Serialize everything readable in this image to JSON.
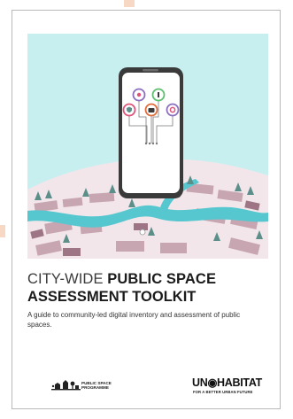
{
  "cover": {
    "title_light": "CITY-WIDE",
    "title_bold_1": "PUBLIC SPACE",
    "title_bold_2": "ASSESSMENT TOOLKIT",
    "subtitle": "A guide to community-led digital inventory and assessment of public spaces."
  },
  "logos": {
    "psp_line1": "PUBLIC SPACE",
    "psp_line2": "PROGRAMME",
    "unhabitat_name": "UN◉HABITAT",
    "unhabitat_tagline": "FOR A BETTER URBAN FUTURE"
  },
  "colors": {
    "sky": "#c8eff0",
    "river": "#56c7cf",
    "land": "#f2e6ea",
    "blocks": "#b9939f",
    "phone": "#3a3a3a",
    "title_text": "#1b1b1b"
  },
  "icons": [
    "pin-icon",
    "info-icon",
    "shield-icon",
    "camera-icon",
    "ring-icon"
  ]
}
